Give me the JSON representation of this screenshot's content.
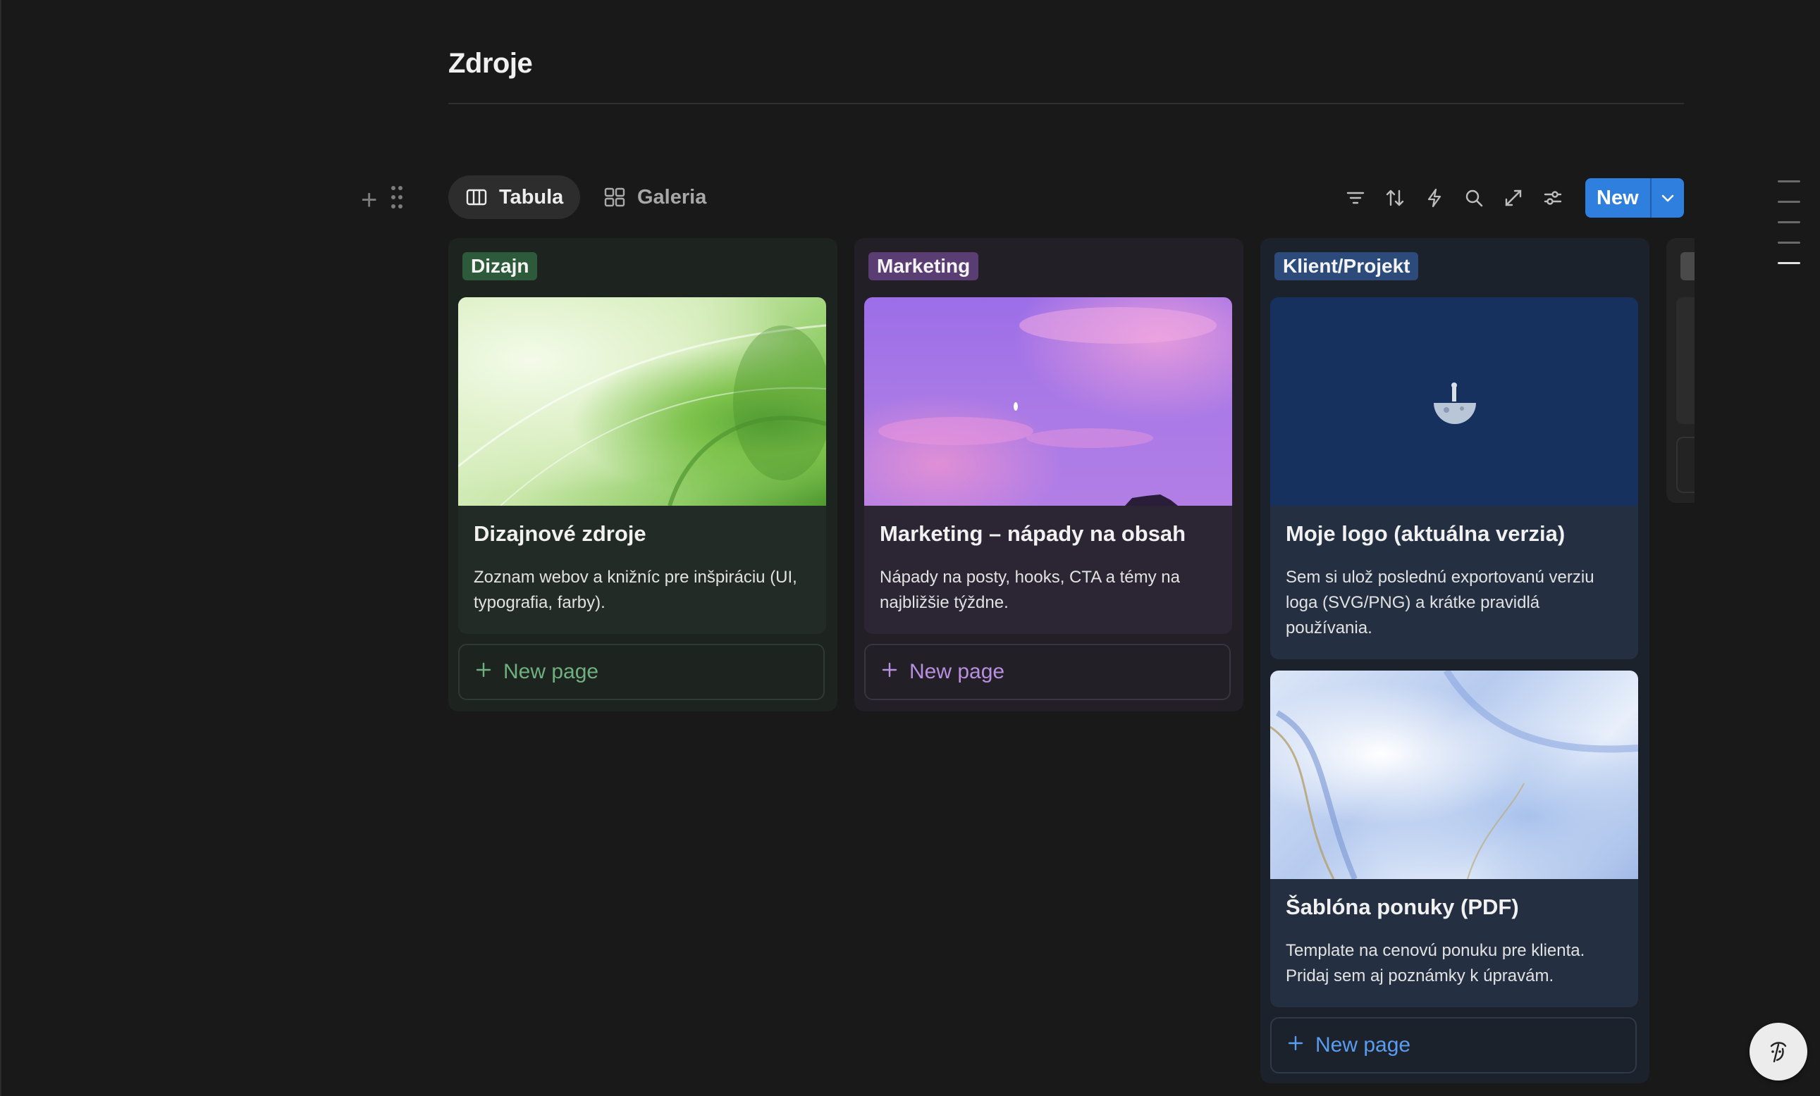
{
  "page": {
    "title": "Zdroje"
  },
  "views": {
    "tabs": [
      {
        "label": "Tabula",
        "icon": "board-icon",
        "active": true
      },
      {
        "label": "Galeria",
        "icon": "gallery-icon",
        "active": false
      }
    ]
  },
  "toolbar": {
    "icons": [
      "filter-icon",
      "sort-icon",
      "automation-icon",
      "search-icon",
      "expand-icon",
      "settings-icon"
    ],
    "new_label": "New"
  },
  "columns": [
    {
      "label": "Dizajn",
      "color": "#2d5a3a",
      "cards": [
        {
          "title": "Dizajnové zdroje",
          "description": "Zoznam webov a knižníc pre inšpiráciu (UI, typografia, farby)."
        }
      ],
      "new_page_label": "New page"
    },
    {
      "label": "Marketing",
      "color": "#5a3d72",
      "cards": [
        {
          "title": "Marketing – nápady na obsah",
          "description": "Nápady na posty, hooks, CTA a témy na najbližšie týždne."
        }
      ],
      "new_page_label": "New page"
    },
    {
      "label": "Klient/Projekt",
      "color": "#2d4b7a",
      "cards": [
        {
          "title": "Moje logo (aktuálna verzia)",
          "description": "Sem si ulož poslednú exportovanú verziu loga (SVG/PNG) a krátke pravidlá používania."
        },
        {
          "title": "Šablóna ponuky (PDF)",
          "description": "Template na cenovú ponuku pre klienta. Pridaj sem aj poznámky k úpravám."
        }
      ],
      "new_page_label": "New page"
    }
  ],
  "colors": {
    "accent": "#2f7fdf",
    "background": "#191919"
  }
}
